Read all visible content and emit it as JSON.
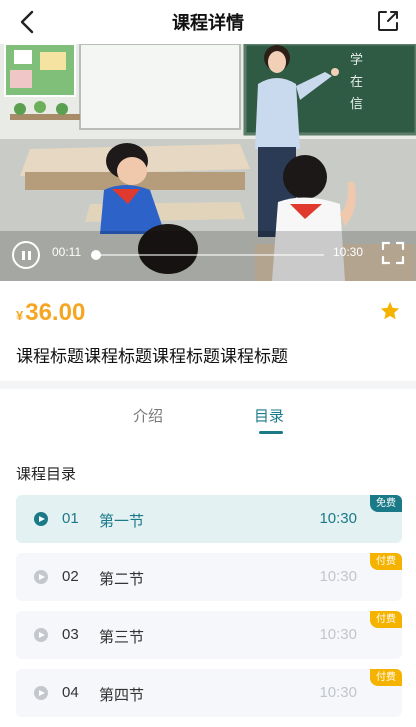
{
  "header": {
    "title": "课程详情",
    "back_icon": "back-arrow-icon",
    "share_icon": "share-icon"
  },
  "video": {
    "current_time": "00:11",
    "total_time": "10:30",
    "progress": 0.018,
    "board_text": [
      "学",
      "在",
      "信"
    ]
  },
  "course": {
    "currency": "¥",
    "price": "36.00",
    "title": "课程标题课程标题课程标题课程标题"
  },
  "tabs": [
    {
      "label": "介绍",
      "active": false
    },
    {
      "label": "目录",
      "active": true
    }
  ],
  "catalog": {
    "title": "课程目录",
    "lessons": [
      {
        "number": "01",
        "name": "第一节",
        "duration": "10:30",
        "badge": "免费",
        "active": true
      },
      {
        "number": "02",
        "name": "第二节",
        "duration": "10:30",
        "badge": "付费",
        "active": false
      },
      {
        "number": "03",
        "name": "第三节",
        "duration": "10:30",
        "badge": "付费",
        "active": false
      },
      {
        "number": "04",
        "name": "第四节",
        "duration": "10:30",
        "badge": "付费",
        "active": false
      }
    ]
  },
  "colors": {
    "accent": "#1b7a88",
    "price": "#f5a623",
    "badge_paid": "#f5b300"
  }
}
